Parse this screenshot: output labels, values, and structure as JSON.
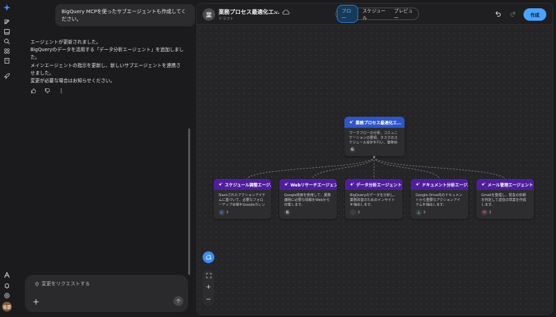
{
  "user_message": "BigQuery MCPを使ったサブエージェントも作成してください。",
  "reply": {
    "line1": "エージェントが更新されました。",
    "line2": "BigQueryのデータを活用する「データ分析エージェント」を追加しました。",
    "line3": "メインエージェントの指示を更新し、新しいサブエージェントを連携させました。",
    "line4": "変更が必要な場合はお知らせください。"
  },
  "composer": {
    "placeholder": "変更をリクエストする"
  },
  "avatar_initials": "竜慶",
  "project": {
    "title": "業務プロセス最適化エ…",
    "status": "ドラフト",
    "badge": "業"
  },
  "tabs": [
    "フロー",
    "スケジュール",
    "プレビュー"
  ],
  "publish_label": "作成",
  "main_node": {
    "title": "業務プロセス最適化エ…",
    "desc": "ワークフローの分析、コミュニケーションの要領、タスクのスケジュール設定を行い、業務効率を…",
    "tool_glyph": "G",
    "tool_count": ""
  },
  "sub_nodes": [
    {
      "title": "スケジュール調整エージ…",
      "desc": "Slackされたアクションアイテムに基づいて、必要なフォローアップ会議をGoogleカレンダーでスケ…",
      "tool_glyph": "▦",
      "tool_count": "3",
      "tool_color": "#3d7cf0"
    },
    {
      "title": "Webリサーチエージェント",
      "desc": "Google検索を使用して、業務課題に必要な情報をWebから収集します。",
      "tool_glyph": "G",
      "tool_count": "",
      "tool_color": "#e8e8e8"
    },
    {
      "title": "データ分析エージェント",
      "desc": "BigQueryのデータを分析し、業務改善のためのインサイトを抽出します。",
      "tool_glyph": "",
      "tool_count": "3",
      "tool_color": "#3d7cf0"
    },
    {
      "title": "ドキュメント分析エージ…",
      "desc": "Google Drive内のドキュメントから重要なアクションアイテムを抽出します。",
      "tool_glyph": "▲",
      "tool_count": "3",
      "tool_color": "#1fa463"
    },
    {
      "title": "メール管理エージェント",
      "desc": "Gmailを整理し、緊急の依頼を判定して返信の草案を作成します。",
      "tool_glyph": "M",
      "tool_count": "3",
      "tool_color": "#ea4335"
    }
  ],
  "colors": {
    "accent": "#4aa3ff",
    "main_head": "#2f55c8",
    "sub_head": "#4f1e9e",
    "panel_bg": "#1f1f21"
  }
}
